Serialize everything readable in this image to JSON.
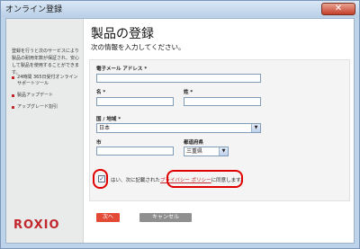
{
  "window": {
    "title": "オンライン登録",
    "close_label": "✕"
  },
  "sidebar": {
    "description": "登録を行うと次のサービスにより 製品の耐用年数が保証され、安心して製品を使用することができます。",
    "items": [
      {
        "label": "24時間 365日受付オンライン サポートツール"
      },
      {
        "label": "製品アップデート"
      },
      {
        "label": "アップグレード割引"
      }
    ],
    "logo": "ROXIO"
  },
  "main": {
    "title": "製品の登録",
    "subtitle": "次の情報を入力してください。"
  },
  "form": {
    "email": {
      "label": "電子メール アドレス *",
      "value": ""
    },
    "first_name": {
      "label": "名 *",
      "value": ""
    },
    "last_name": {
      "label": "姓 *",
      "value": ""
    },
    "country": {
      "label": "国 / 地域 *",
      "value": "日本"
    },
    "city": {
      "label": "市",
      "value": ""
    },
    "prefecture": {
      "label": "都道府県",
      "value": "三重県"
    },
    "consent": {
      "checked": true,
      "prefix": "はい、次に記載された",
      "link": "プライバシー ポリシー",
      "suffix": "に同意します。"
    }
  },
  "buttons": {
    "next": "次へ",
    "cancel": "キャンセル"
  },
  "colors": {
    "accent": "#c1272d",
    "annotation": "#e00000"
  }
}
